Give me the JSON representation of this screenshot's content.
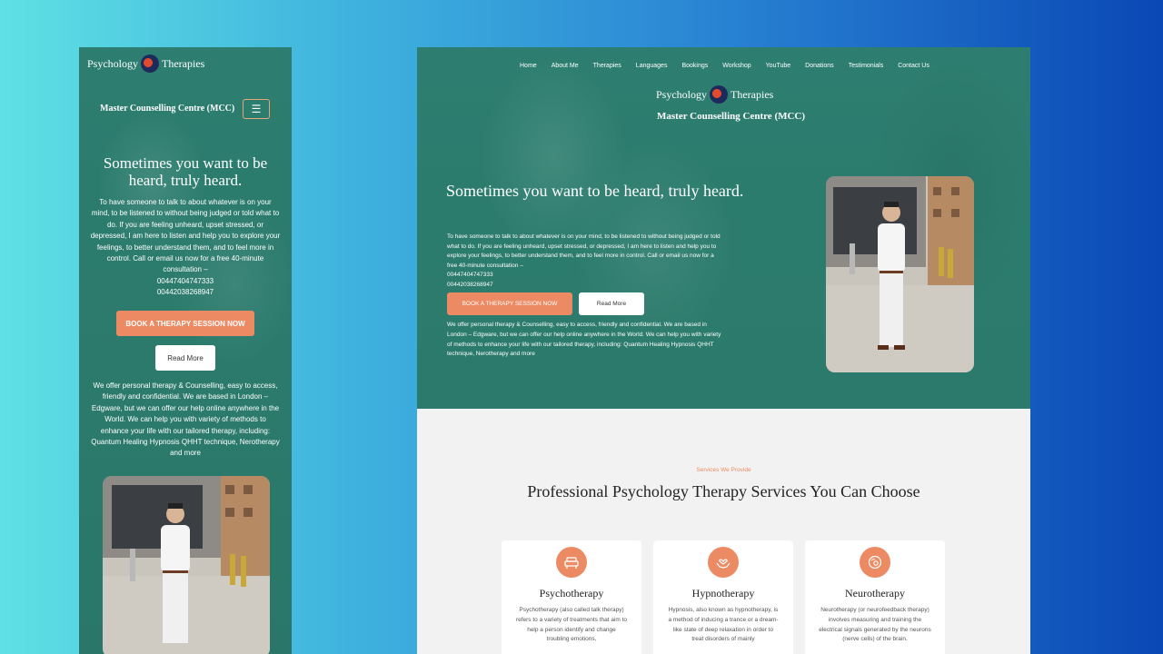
{
  "brand": {
    "logo_left": "Psychology",
    "logo_right": "Therapies",
    "name": "Master Counselling Centre (MCC)"
  },
  "nav": [
    "Home",
    "About Me",
    "Therapies",
    "Languages",
    "Bookings",
    "Workshop",
    "YouTube",
    "Donations",
    "Testimonials",
    "Contact Us"
  ],
  "hero": {
    "title": "Sometimes you want to be heard, truly heard.",
    "text": "To have someone to talk to about whatever is on your mind, to be listened to without being judged or told what to do. If you are feeling unheard, upset stressed, or depressed, I am here to listen and help you to explore your feelings, to better understand them, and to feel more in control. Call or email us now for a free 40-minute consultation –",
    "phone1": "00447404747333",
    "phone2": "00442038268947",
    "book_label": "BOOK A THERAPY SESSION NOW",
    "read_more": "Read More",
    "offer": "We offer personal therapy & Counselling, easy to access, friendly and confidential.   We are based in London – Edgware, but we can offer our help online anywhere in the World. We can help you with variety of methods to enhance your life with our tailored therapy, including: Quantum Healing Hypnosis QHHT technique, Nerotherapy and more"
  },
  "services": {
    "tag": "Services We Provide",
    "title": "Professional Psychology Therapy Services You Can Choose",
    "cards": [
      {
        "title": "Psychotherapy",
        "text": "Psychotherapy (also called talk therapy) refers to a variety of treatments that aim to help a person identify and change troubling emotions,",
        "icon": "therapy-couch-icon"
      },
      {
        "title": "Hypnotherapy",
        "text": "Hypnosis, also known as hypnotherapy, is a method of inducing a trance or a dream-like state of deep relaxation in order to treat disorders of mainly",
        "icon": "hands-heart-icon"
      },
      {
        "title": "Neurotherapy",
        "text": "Neurotherapy (or neurofeedback therapy) involves measuring and training the electrical signals generated by the neurons (nerve cells) of the brain.",
        "icon": "brain-gear-icon"
      }
    ]
  },
  "colors": {
    "hero_green": "#2c7a6c",
    "accent": "#ec8a63"
  }
}
